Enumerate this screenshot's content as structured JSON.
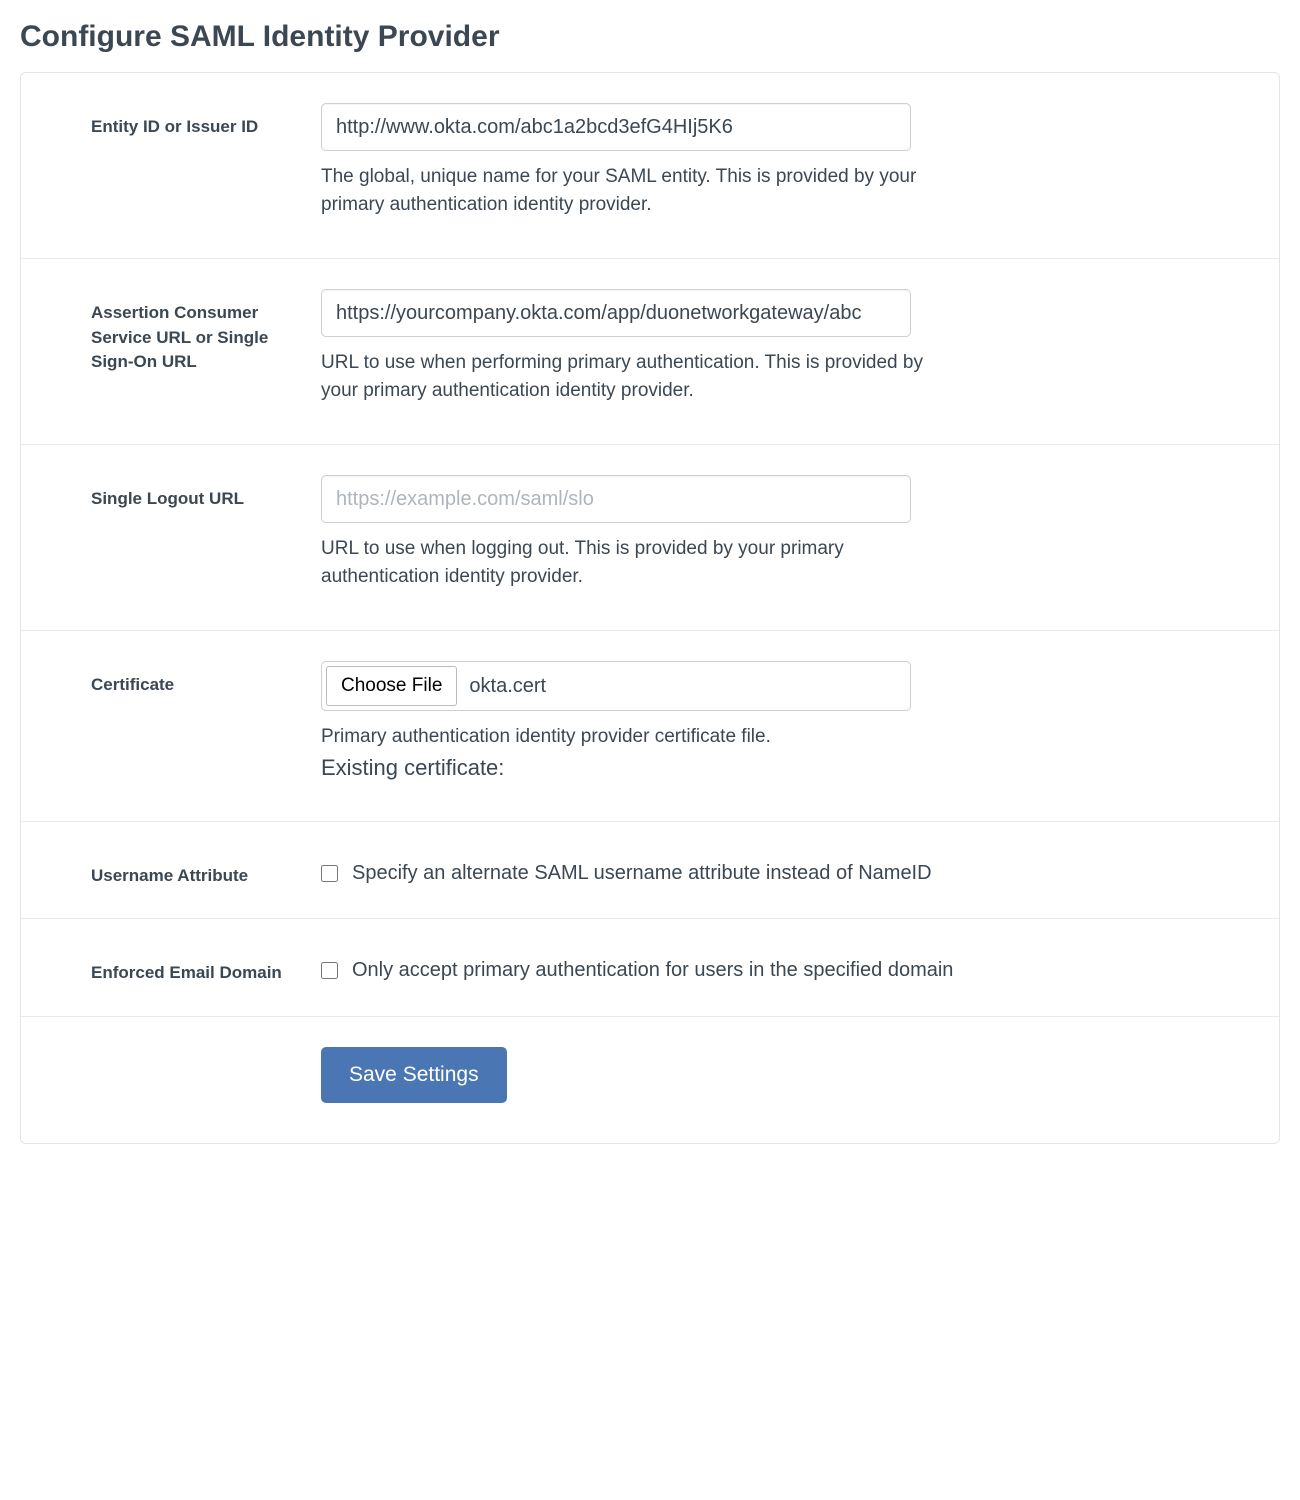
{
  "page": {
    "title": "Configure SAML Identity Provider"
  },
  "fields": {
    "entity_id": {
      "label": "Entity ID or Issuer ID",
      "value": "http://www.okta.com/abc1a2bcd3efG4HIj5K6",
      "help": "The global, unique name for your SAML entity. This is provided by your primary authentication identity provider."
    },
    "acs_url": {
      "label": "Assertion Consumer Service URL or Single Sign-On URL",
      "value": "https://yourcompany.okta.com/app/duonetworkgateway/abc",
      "help": "URL to use when performing primary authentication. This is provided by your primary authentication identity provider."
    },
    "slo_url": {
      "label": "Single Logout URL",
      "value": "",
      "placeholder": "https://example.com/saml/slo",
      "help": "URL to use when logging out. This is provided by your primary authentication identity provider."
    },
    "certificate": {
      "label": "Certificate",
      "button_label": "Choose File",
      "file_name": "okta.cert",
      "help": "Primary authentication identity provider certificate file.",
      "existing_label": "Existing certificate:"
    },
    "username_attr": {
      "label": "Username Attribute",
      "checkbox_label": "Specify an alternate SAML username attribute instead of NameID",
      "checked": false
    },
    "enforced_domain": {
      "label": "Enforced Email Domain",
      "checkbox_label": "Only accept primary authentication for users in the specified domain",
      "checked": false
    }
  },
  "actions": {
    "save_label": "Save Settings"
  }
}
